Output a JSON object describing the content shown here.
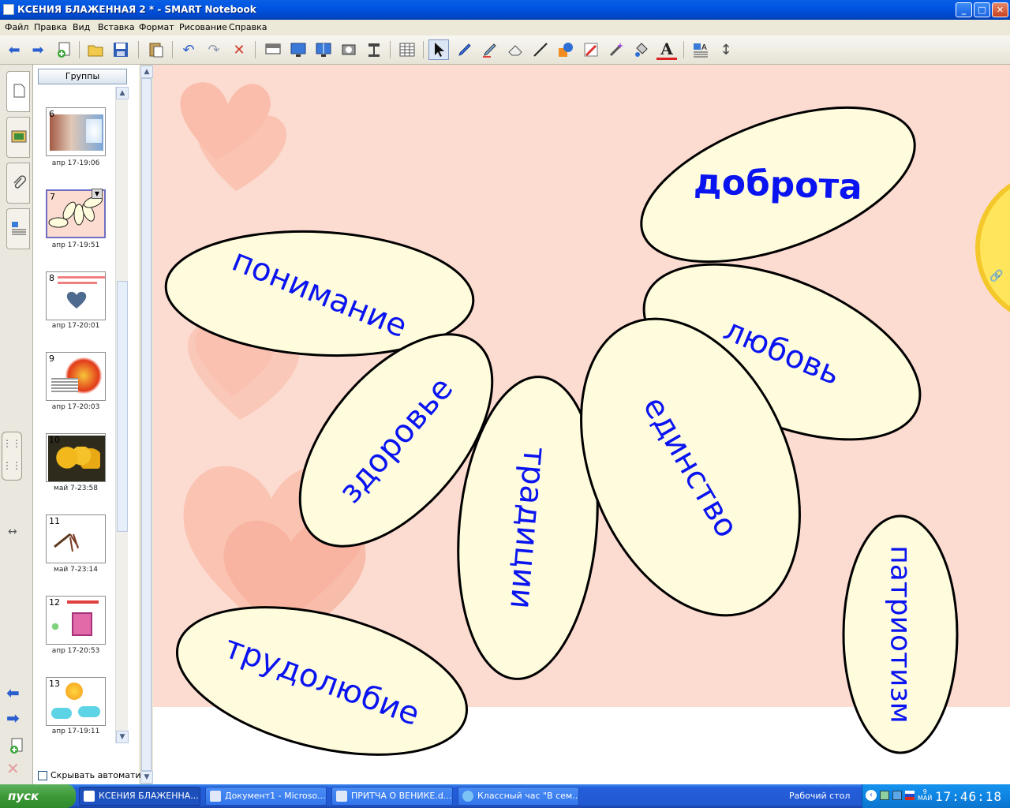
{
  "window": {
    "title": "КСЕНИЯ БЛАЖЕННАЯ 2 * - SMART Notebook",
    "minimize": "_",
    "maximize": "□",
    "close": "✕"
  },
  "menu": [
    "Файл",
    "Правка",
    "Вид",
    "Вставка",
    "Формат",
    "Рисование",
    "Справка"
  ],
  "toolbar_icons": [
    "back-icon",
    "forward-icon",
    "add-page-icon",
    "open-icon",
    "save-icon",
    "paste-icon",
    "undo-icon",
    "redo-icon",
    "delete-icon",
    "screen-shade-icon",
    "full-screen-icon",
    "dual-page-icon",
    "capture-icon",
    "document-camera-icon",
    "table-icon",
    "select-icon",
    "pen-icon",
    "creative-pen-icon",
    "eraser-icon",
    "line-icon",
    "shapes-icon",
    "magic-pen-icon",
    "shape-recognition-pen-icon",
    "fill-icon",
    "text-icon",
    "properties-icon",
    "toolbar-move-icon"
  ],
  "sorter": {
    "groups_label": "Группы",
    "autohide_label": "Скрывать автомати",
    "pages": [
      {
        "num": "6",
        "caption": "апр 17-19:06"
      },
      {
        "num": "7",
        "caption": "апр 17-19:51"
      },
      {
        "num": "8",
        "caption": "апр 17-20:01"
      },
      {
        "num": "9",
        "caption": "апр 17-20:03"
      },
      {
        "num": "10",
        "caption": "май 7-23:58"
      },
      {
        "num": "11",
        "caption": "май 7-23:14"
      },
      {
        "num": "12",
        "caption": "апр 17-20:53"
      },
      {
        "num": "13",
        "caption": "апр 17-19:11"
      }
    ]
  },
  "petals": [
    {
      "word": "доброта"
    },
    {
      "word": "понимание"
    },
    {
      "word": "любовь"
    },
    {
      "word": "здоровье"
    },
    {
      "word": "традиции"
    },
    {
      "word": "единство"
    },
    {
      "word": "патриотизм"
    },
    {
      "word": "трудолюбие"
    }
  ],
  "colors": {
    "canvas_bg": "#FCDBD0",
    "petal_fill": "#FFFCDD",
    "petal_text": "#0A14F0",
    "heart": "#F7A48C"
  },
  "taskbar": {
    "start": "пуск",
    "tasks": [
      "КСЕНИЯ БЛАЖЕННА...",
      "Документ1 - Microso...",
      "ПРИТЧА О ВЕНИКЕ.d...",
      "Классный час \"В сем..."
    ],
    "desktop": "Рабочий стол",
    "clock": "17:46:18",
    "day": "9",
    "month": "МАЙ"
  }
}
